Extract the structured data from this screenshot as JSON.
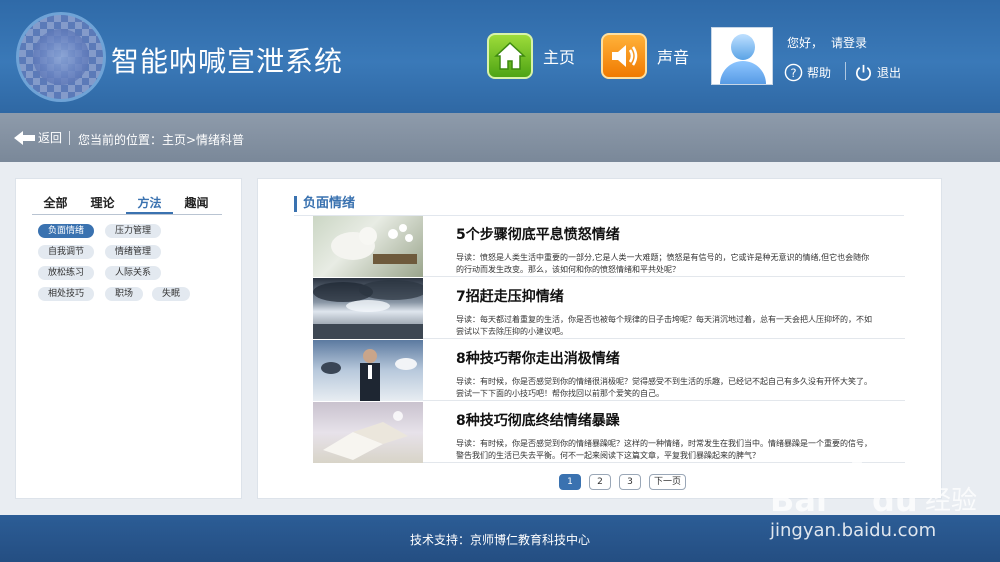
{
  "header": {
    "app_title": "智能呐喊宣泄系统",
    "nav": {
      "home": "主页",
      "sound": "声音"
    },
    "greeting": "您好，",
    "login": "请登录",
    "help": "帮助",
    "logout": "退出"
  },
  "breadcrumb": {
    "back": "返回",
    "location": "您当前的位置：主页>情绪科普"
  },
  "sidebar": {
    "tabs": [
      "全部",
      "理论",
      "方法",
      "趣闻"
    ],
    "active_tab": "方法",
    "tags": [
      "负面情绪",
      "压力管理",
      "自我调节",
      "情绪管理",
      "放松练习",
      "人际关系",
      "相处技巧",
      "职场",
      "失眠"
    ],
    "active_tag": "负面情绪"
  },
  "main": {
    "section_title": "负面情绪",
    "articles": [
      {
        "title": "5个步骤彻底平息愤怒情绪",
        "summary": "导读：愤怒是人类生活中重要的一部分,它是人类一大难题；愤怒是有信号的，它或许是种无意识的情绪,但它也会随你的行动而发生改变。那么，该如何和你的愤怒情绪和平共处呢？"
      },
      {
        "title": "7招赶走压抑情绪",
        "summary": "导读：每天都过着重复的生活，你是否也被每个规律的日子击垮呢？每天消沉地过着，总有一天会把人压抑坏的，不如尝试以下去除压抑的小建议吧。"
      },
      {
        "title": "8种技巧帮你走出消极情绪",
        "summary": "导读：有时候，你是否感觉到你的情绪很消极呢？觉得感受不到生活的乐趣，已经记不起自己有多久没有开怀大笑了。尝试一下下面的小技巧吧！帮你找回以前那个爱笑的自己。"
      },
      {
        "title": "8种技巧彻底终结情绪暴躁",
        "summary": "导读：有时候，你是否感觉到你的情绪暴躁呢？这样的一种情绪，时常发生在我们当中。情绪暴躁是一个重要的信号，警告我们的生活已失去平衡。何不一起来阅读下这篇文章，平复我们暴躁起来的脾气？"
      }
    ],
    "pagination": {
      "pages": [
        "1",
        "2",
        "3"
      ],
      "next": "下一页",
      "current": "1"
    }
  },
  "footer": {
    "text": "技术支持：京师博仁教育科技中心"
  },
  "watermark": {
    "text": "jingyan.baidu.com"
  },
  "colors": {
    "header_blue": "#2f6aa8",
    "accent": "#3a72b0",
    "footer_blue": "#244e82",
    "home_green": "#6cc41e",
    "sound_orange": "#f58a0c"
  },
  "icons": [
    "home-icon",
    "speaker-icon",
    "user-avatar-icon",
    "help-icon",
    "power-icon",
    "back-arrow-icon"
  ]
}
